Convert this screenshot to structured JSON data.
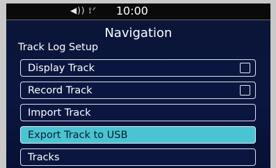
{
  "status_bar": {
    "icons_text": "◀)) ⟟ᐟ",
    "icons": [
      "speaker-icon",
      "signal-icon"
    ],
    "time": "10:00"
  },
  "header": {
    "title": "Navigation",
    "section": "Track Log Setup"
  },
  "menu": {
    "items": [
      {
        "label": "Display Track",
        "checkbox": true,
        "checked": false
      },
      {
        "label": "Record Track",
        "checkbox": true,
        "checked": false
      },
      {
        "label": "Import Track"
      },
      {
        "label": "Export Track to USB",
        "selected": true
      },
      {
        "label": "Tracks"
      }
    ]
  },
  "colors": {
    "background": "#0b1640",
    "selected": "#49c4d2",
    "border": "#dfe3ea"
  }
}
